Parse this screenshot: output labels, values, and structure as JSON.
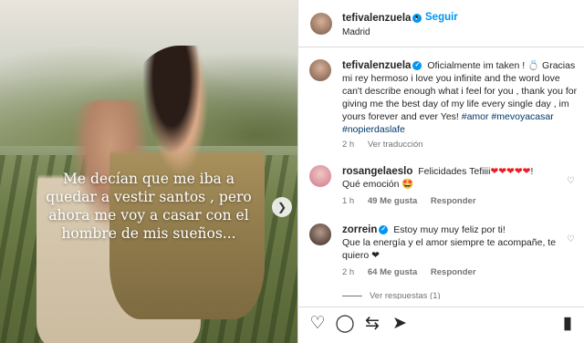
{
  "post": {
    "image_caption_lines": [
      "Me decían que me iba a",
      "quedar a vestir santos , pero",
      "ahora me voy a casar con el",
      "hombre de mis sueños..."
    ]
  },
  "header": {
    "username": "tefivalenzuela",
    "separator": "•",
    "follow_label": "Seguir",
    "location": "Madrid"
  },
  "caption": {
    "username": "tefivalenzuela",
    "text": "Oficialmente im taken ! 💍 Gracias mi rey hermoso i love you infinite and the word love can't describe enough what i feel for you , thank you for giving me the best day of my life every single day , im yours forever and ever Yes!",
    "hashtags": "#amor #mevoyacasar #nopierdaslafe",
    "time": "2 h",
    "see_translation": "Ver traducción"
  },
  "comments": [
    {
      "username": "rosangelaeslo",
      "text_prefix": "Felicidades Tefiiii",
      "hearts": "❤❤❤❤❤",
      "text_suffix": "!",
      "text_line2": "Qué emoción 🤩",
      "time": "1 h",
      "likes": "49 Me gusta",
      "reply": "Responder"
    },
    {
      "username": "zorrein",
      "text": "Estoy muy muy feliz por ti!",
      "text_line2": "Que la energía y el amor siempre te acompañe, te",
      "text_line3": "quiero ❤",
      "time": "2 h",
      "likes": "64 Me gusta",
      "reply": "Responder",
      "more_replies": "Ver respuestas (1)"
    }
  ],
  "actions": {
    "like_icon": "heart-icon",
    "comment_icon": "comment-icon",
    "share_icon": "repost-icon",
    "send_icon": "send-icon",
    "save_icon": "bookmark-icon"
  },
  "colors": {
    "accent": "#0095f6",
    "verified": "#0095f6",
    "hashtag": "#00376b",
    "heart": "#ed1c24"
  }
}
